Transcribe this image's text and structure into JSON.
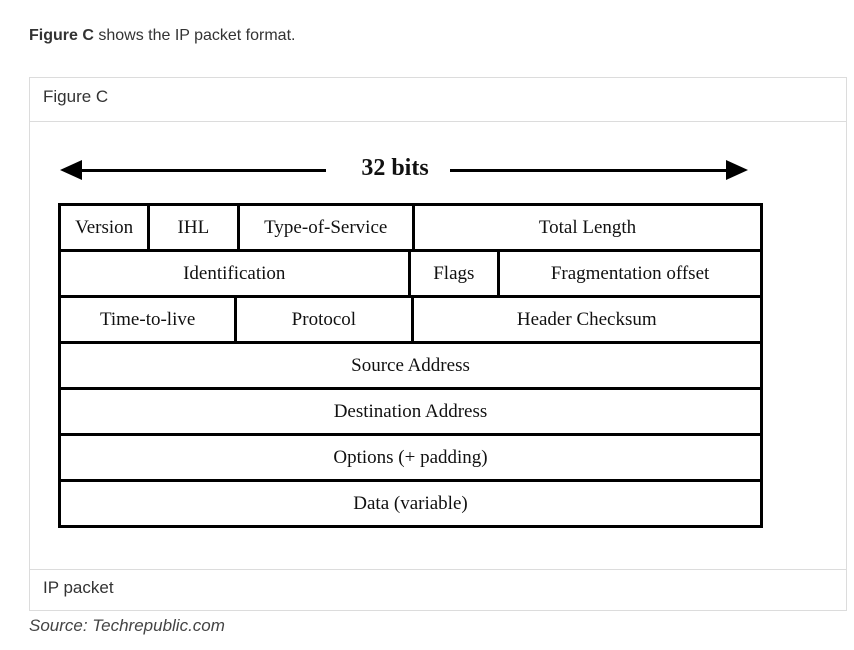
{
  "intro": {
    "bold": "Figure C",
    "rest": " shows the IP packet format."
  },
  "figure": {
    "title": "Figure C",
    "caption": "IP packet",
    "width_label": "32 bits",
    "rows": [
      {
        "cells": [
          {
            "label": "Version",
            "bits": 4
          },
          {
            "label": "IHL",
            "bits": 4
          },
          {
            "label": "Type-of-Service",
            "bits": 8
          },
          {
            "label": "Total Length",
            "bits": 16
          }
        ]
      },
      {
        "cells": [
          {
            "label": "Identification",
            "bits": 16
          },
          {
            "label": "Flags",
            "bits": 4
          },
          {
            "label": "Fragmentation offset",
            "bits": 12
          }
        ]
      },
      {
        "cells": [
          {
            "label": "Time-to-live",
            "bits": 8
          },
          {
            "label": "Protocol",
            "bits": 8
          },
          {
            "label": "Header Checksum",
            "bits": 16
          }
        ]
      },
      {
        "cells": [
          {
            "label": "Source Address",
            "bits": 32
          }
        ]
      },
      {
        "cells": [
          {
            "label": "Destination Address",
            "bits": 32
          }
        ]
      },
      {
        "cells": [
          {
            "label": "Options (+ padding)",
            "bits": 32
          }
        ]
      },
      {
        "cells": [
          {
            "label": "Data (variable)",
            "bits": 32
          }
        ]
      }
    ]
  },
  "source": "Source: Techrepublic.com"
}
